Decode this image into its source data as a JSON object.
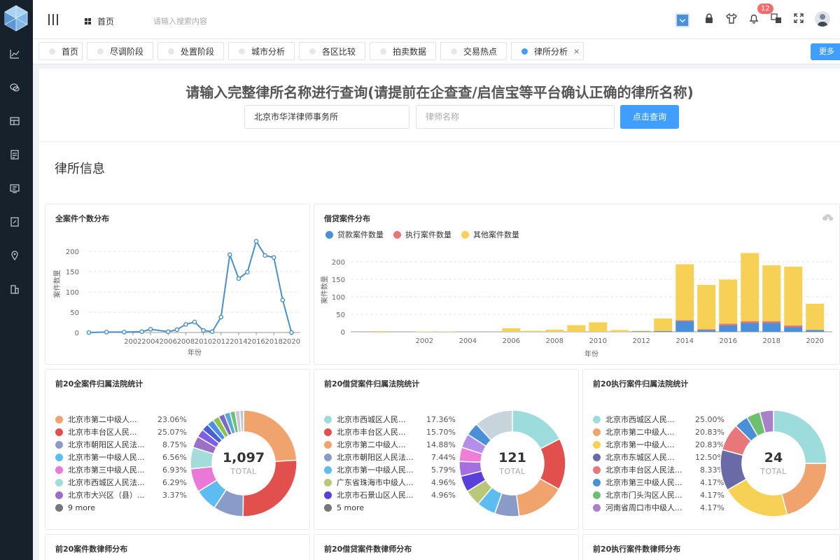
{
  "topbar": {
    "home_label": "首页",
    "search_placeholder": "请输入搜索内容",
    "notification_count": "12"
  },
  "tags": [
    {
      "label": "首页"
    },
    {
      "label": "尽调阶段"
    },
    {
      "label": "处置阶段"
    },
    {
      "label": "城市分析"
    },
    {
      "label": "各区比较"
    },
    {
      "label": "拍卖数据"
    },
    {
      "label": "交易热点"
    },
    {
      "label": "律所分析",
      "close": "×"
    }
  ],
  "more_label": "更多",
  "query": {
    "title": "请输入完整律所名称进行查询(请提前在企查查/启信宝等平台确认正确的律所名称)",
    "firm_value": "北京市华洋律师事务所",
    "lawyer_placeholder": "律师名称",
    "button_label": "点击查询"
  },
  "section_title": "律所信息",
  "colors": {
    "primary": "#409eff",
    "sidebar": "#17212b",
    "line": "#4a90c8",
    "loan": "#4a90d9",
    "exec": "#e8777a",
    "other": "#f7d155"
  },
  "chart_data": [
    {
      "type": "line",
      "title": "全案件个数分布",
      "xlabel": "年份",
      "ylabel": "案件数量",
      "x": [
        1997,
        1999,
        2001,
        2003,
        2004,
        2006,
        2007,
        2008,
        2009,
        2010,
        2011,
        2012,
        2013,
        2014,
        2015,
        2016,
        2017,
        2018,
        2019,
        2020
      ],
      "y": [
        0,
        1,
        1,
        2,
        8,
        2,
        7,
        20,
        26,
        5,
        2,
        38,
        192,
        133,
        149,
        225,
        190,
        185,
        80,
        0
      ],
      "ylim": [
        0,
        240
      ],
      "yticks": [
        0,
        50,
        100,
        150,
        200
      ],
      "xticks": [
        "2002",
        "2004",
        "2006",
        "2008",
        "2010",
        "2012",
        "2014",
        "2016",
        "2018",
        "2020"
      ]
    },
    {
      "type": "bar",
      "stacked": true,
      "title": "借贷案件分布",
      "xlabel": "年份",
      "ylabel": "案件数量",
      "categories": [
        "2000",
        "2002",
        "2003",
        "2004",
        "2006",
        "2007",
        "2008",
        "2009",
        "2010",
        "2011",
        "2012",
        "2013",
        "2014",
        "2015",
        "2016",
        "2017",
        "2018",
        "2019",
        "2020"
      ],
      "series": [
        {
          "name": "贷款案件数量",
          "values": [
            0,
            0,
            0,
            0,
            0,
            0,
            0,
            0,
            0,
            0,
            1,
            2,
            30,
            5,
            18,
            25,
            25,
            13,
            5
          ]
        },
        {
          "name": "执行案件数量",
          "values": [
            0,
            0,
            0,
            0,
            0,
            0,
            0,
            0,
            0,
            0,
            0,
            0,
            3,
            2,
            5,
            5,
            5,
            5,
            0
          ]
        },
        {
          "name": "其他案件数量",
          "values": [
            2,
            1,
            1,
            0,
            10,
            3,
            6,
            19,
            27,
            5,
            2,
            36,
            160,
            127,
            126,
            195,
            160,
            168,
            75
          ]
        }
      ],
      "ylim": [
        0,
        240
      ],
      "yticks": [
        0,
        50,
        100,
        150,
        200
      ],
      "xticks": [
        "2002",
        "2004",
        "2006",
        "2008",
        "2010",
        "2012",
        "2014",
        "2016",
        "2018",
        "2020"
      ],
      "legend_position": "top-left"
    },
    {
      "type": "pie",
      "title": "前20全案件归属法院统计",
      "total": "1,097",
      "total_label": "TOTAL",
      "labels": [
        "北京市第二中级人...",
        "北京市丰台区人民...",
        "北京市朝阳区人民法...",
        "北京市第一中级人民...",
        "北京市第三中级人民...",
        "北京市西城区人民法...",
        "北京市大兴区（县）..."
      ],
      "percents": [
        "23.06%",
        "25.07%",
        "8.75%",
        "6.56%",
        "6.93%",
        "6.29%",
        "3.37%"
      ],
      "values": [
        23.06,
        25.07,
        8.75,
        6.56,
        6.93,
        6.29,
        3.37,
        2.4,
        2.1,
        2.0,
        1.9,
        1.8,
        1.7,
        1.5,
        1.4,
        1.1
      ],
      "colors": [
        "#f0a36c",
        "#e2504d",
        "#8b9bc8",
        "#5dbdf0",
        "#ea78d8",
        "#a3dcd8",
        "#9b6fc8",
        "#7d5fe8",
        "#4a5fd4",
        "#4a8ee8",
        "#8bc34a",
        "#7a6cc4",
        "#5aa7dc",
        "#6cc070",
        "#c8c8d8",
        "#b8c8d0"
      ],
      "more": "9 more"
    },
    {
      "type": "pie",
      "title": "前20借贷案件归属法院统计",
      "total": "121",
      "total_label": "TOTAL",
      "labels": [
        "北京市西城区人民...",
        "北京市丰台区人民...",
        "北京市第二中级人...",
        "北京市朝阳区人民法...",
        "北京市第一中级人民...",
        "广东省珠海市中级人...",
        "北京市石景山区人民..."
      ],
      "percents": [
        "17.36%",
        "15.70%",
        "14.88%",
        "7.44%",
        "5.79%",
        "4.96%",
        "4.96%"
      ],
      "values": [
        17.36,
        15.7,
        14.88,
        7.44,
        5.79,
        4.96,
        4.96,
        4.5,
        4.3,
        4.3,
        4.0,
        11.8
      ],
      "colors": [
        "#9cdcdc",
        "#e2504d",
        "#f0a36c",
        "#8b9bc8",
        "#5dbdf0",
        "#b8c878",
        "#5a3fd8",
        "#a66fe0",
        "#f07ed8",
        "#b48ee8",
        "#4a90d9",
        "#c8d4dc"
      ],
      "more": "5 more"
    },
    {
      "type": "pie",
      "title": "前20执行案件归属法院统计",
      "total": "24",
      "total_label": "TOTAL",
      "labels": [
        "北京市西城区人民...",
        "北京市第二中级人...",
        "北京市第一中级人...",
        "北京市东城区人民...",
        "北京市丰台区人民法...",
        "北京市第三中级人民...",
        "北京市门头沟区人民...",
        "河南省周口市中级人..."
      ],
      "percents": [
        "25.00%",
        "20.83%",
        "20.83%",
        "12.50%",
        "8.33%",
        "4.17%",
        "4.17%",
        "4.17%"
      ],
      "values": [
        25.0,
        20.83,
        20.83,
        12.5,
        8.33,
        4.17,
        4.17,
        4.17
      ],
      "colors": [
        "#9cdcdc",
        "#f0a36c",
        "#f7d155",
        "#6a6aa8",
        "#e8777a",
        "#4a90d9",
        "#6cc070",
        "#a882c8"
      ]
    }
  ],
  "bottom_titles": [
    "前20案件数律师分布",
    "前20借贷案件数律师分布",
    "前20执行案件数律师分布"
  ]
}
